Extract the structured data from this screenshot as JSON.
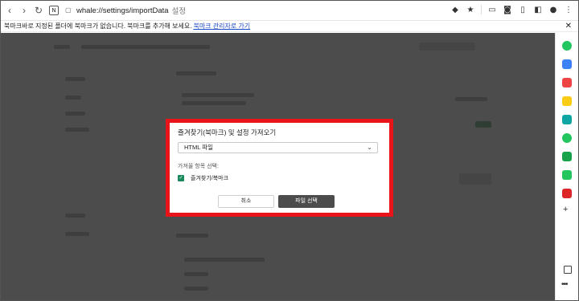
{
  "browser": {
    "url": "whale://settings/importData",
    "tab_title": "설정",
    "site_badge": "N"
  },
  "bookmark_bar": {
    "message": "북마크바로 지정된 폴더에 북마크가 없습니다. 북마크를 추가해 보세요.",
    "link": "북마크 관리자로 가기"
  },
  "dialog": {
    "title": "즐겨찾기(북마크) 및 설정 가져오기",
    "source_select": "HTML 파일",
    "items_label": "가져올 항목 선택:",
    "checkbox_label": "즐겨찾기/북마크",
    "checkbox_checked": true,
    "cancel_label": "취소",
    "choose_file_label": "파일 선택"
  },
  "colors": {
    "highlight": "#e8141a",
    "primary_button": "#4c4c4c",
    "checkbox": "#1a8a5c"
  },
  "sidebar_icons": [
    "green-app-icon",
    "blue-app-icon",
    "red-app-icon",
    "yellow-star-icon",
    "blue-green-app-icon",
    "green-circle-icon",
    "green-chat-icon",
    "green-square-icon",
    "red-app-icon-2"
  ]
}
